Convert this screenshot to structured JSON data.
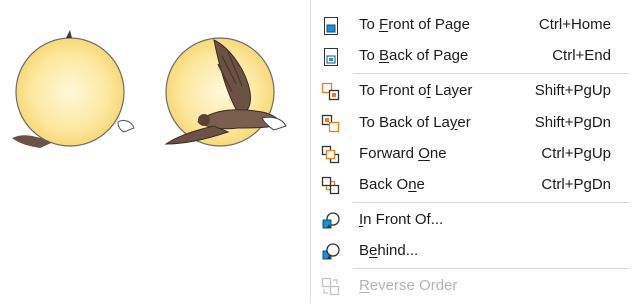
{
  "menu": {
    "items": [
      {
        "id": "to-front-of-page",
        "before": "To ",
        "mnemonic": "F",
        "after": "ront of Page",
        "shortcut": "Ctrl+Home",
        "icon": "to-front-of-page-icon",
        "enabled": true
      },
      {
        "id": "to-back-of-page",
        "before": "To ",
        "mnemonic": "B",
        "after": "ack of Page",
        "shortcut": "Ctrl+End",
        "icon": "to-back-of-page-icon",
        "enabled": true
      },
      {
        "id": "to-front-of-layer",
        "before": "To Front o",
        "mnemonic": "f",
        "after": " Layer",
        "shortcut": "Shift+PgUp",
        "icon": "to-front-of-layer-icon",
        "enabled": true
      },
      {
        "id": "to-back-of-layer",
        "before": "To Back of La",
        "mnemonic": "y",
        "after": "er",
        "shortcut": "Shift+PgDn",
        "icon": "to-back-of-layer-icon",
        "enabled": true
      },
      {
        "id": "forward-one",
        "before": "Forward ",
        "mnemonic": "O",
        "after": "ne",
        "shortcut": "Ctrl+PgUp",
        "icon": "forward-one-icon",
        "enabled": true
      },
      {
        "id": "back-one",
        "before": "Back O",
        "mnemonic": "n",
        "after": "e",
        "shortcut": "Ctrl+PgDn",
        "icon": "back-one-icon",
        "enabled": true
      },
      {
        "id": "in-front-of",
        "before": "",
        "mnemonic": "I",
        "after": "n Front Of...",
        "shortcut": "",
        "icon": "in-front-of-icon",
        "enabled": true
      },
      {
        "id": "behind",
        "before": "B",
        "mnemonic": "e",
        "after": "hind...",
        "shortcut": "",
        "icon": "behind-icon",
        "enabled": true
      },
      {
        "id": "reverse-order",
        "before": "",
        "mnemonic": "R",
        "after": "everse Order",
        "shortcut": "",
        "icon": "reverse-order-icon",
        "enabled": false
      }
    ]
  },
  "colors": {
    "accent_orange": "#f07c1e",
    "accent_blue": "#1a8fd6",
    "moon_fill": "#fce59a",
    "bird_brown": "#6b5244",
    "disabled_text": "#b3b3b3"
  }
}
